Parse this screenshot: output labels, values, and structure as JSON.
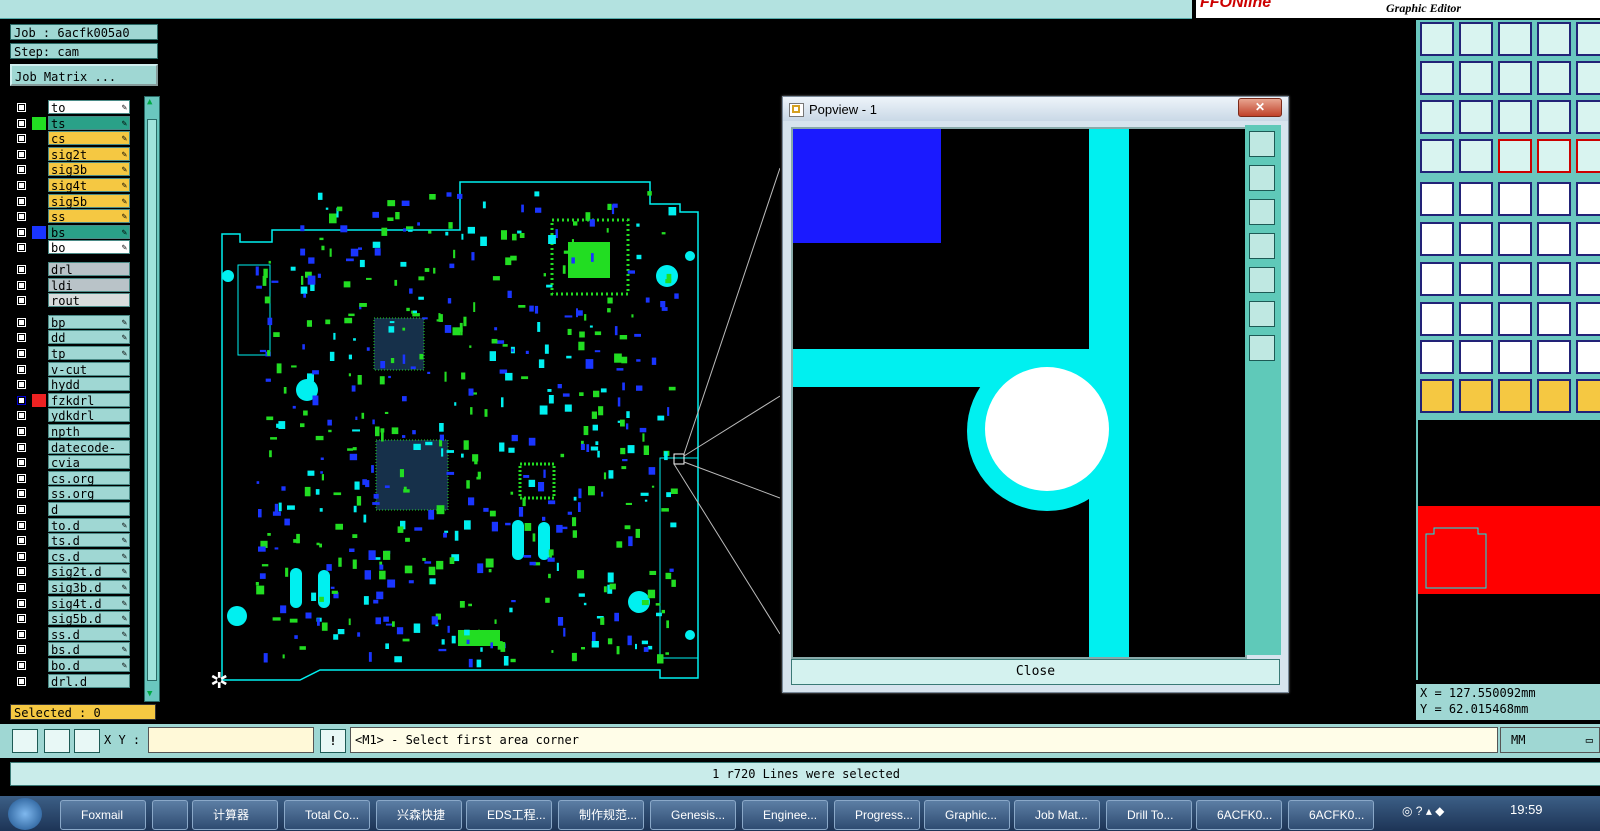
{
  "brand": {
    "logo": "FFONline",
    "subtitle": "Graphic Editor"
  },
  "job": {
    "job_label": "Job : 6acfk005a0",
    "step_label": "Step: cam",
    "matrix_button": "Job Matrix ..."
  },
  "layers": [
    {
      "name": "to",
      "bg": "#ffffff",
      "swatch": "#000000",
      "edit": true
    },
    {
      "name": "ts",
      "bg": "#2aa188",
      "swatch": "#22dd22",
      "edit": true
    },
    {
      "name": "cs",
      "bg": "#f5c842",
      "swatch": "#000000",
      "edit": true
    },
    {
      "name": "sig2t",
      "bg": "#f5c842",
      "swatch": "#000000",
      "edit": true
    },
    {
      "name": "sig3b",
      "bg": "#f5c842",
      "swatch": "#000000",
      "edit": true
    },
    {
      "name": "sig4t",
      "bg": "#f5c842",
      "swatch": "#000000",
      "edit": true
    },
    {
      "name": "sig5b",
      "bg": "#f5c842",
      "swatch": "#000000",
      "edit": true
    },
    {
      "name": "ss",
      "bg": "#f5c842",
      "swatch": "#000000",
      "edit": true
    },
    {
      "name": "bs",
      "bg": "#2aa188",
      "swatch": "#1a35ff",
      "edit": true
    },
    {
      "name": "bo",
      "bg": "#ffffff",
      "swatch": "#000000",
      "edit": true
    },
    {
      "name": "drl",
      "bg": "#b9c3c8",
      "swatch": "#000000",
      "edit": false
    },
    {
      "name": "ldi",
      "bg": "#b9c3c8",
      "swatch": "#000000",
      "edit": false
    },
    {
      "name": "rout",
      "bg": "#d8dcdc",
      "swatch": "#000000",
      "edit": false
    },
    {
      "name": "bp",
      "bg": "#9fd7d3",
      "swatch": "#000000",
      "edit": true
    },
    {
      "name": "dd",
      "bg": "#9fd7d3",
      "swatch": "#000000",
      "edit": true
    },
    {
      "name": "tp",
      "bg": "#9fd7d3",
      "swatch": "#000000",
      "edit": true
    },
    {
      "name": "v-cut",
      "bg": "#9fd7d3",
      "swatch": "#000000",
      "edit": false
    },
    {
      "name": "hydd",
      "bg": "#9fd7d3",
      "swatch": "#000000",
      "edit": false
    },
    {
      "name": "fzkdrl",
      "bg": "#9fd7d3",
      "swatch": "#ee2222",
      "edit": false,
      "active": true
    },
    {
      "name": "ydkdrl",
      "bg": "#9fd7d3",
      "swatch": "#000000",
      "edit": false
    },
    {
      "name": "npth",
      "bg": "#9fd7d3",
      "swatch": "#000000",
      "edit": false
    },
    {
      "name": "datecode-bo",
      "bg": "#9fd7d3",
      "swatch": "#000000",
      "edit": false
    },
    {
      "name": "cvia",
      "bg": "#9fd7d3",
      "swatch": "#000000",
      "edit": false
    },
    {
      "name": "cs.org",
      "bg": "#9fd7d3",
      "swatch": "#000000",
      "edit": false
    },
    {
      "name": "ss.org",
      "bg": "#9fd7d3",
      "swatch": "#000000",
      "edit": false
    },
    {
      "name": "d",
      "bg": "#9fd7d3",
      "swatch": "#000000",
      "edit": false
    },
    {
      "name": "to.d",
      "bg": "#9fd7d3",
      "swatch": "#000000",
      "edit": true
    },
    {
      "name": "ts.d",
      "bg": "#9fd7d3",
      "swatch": "#000000",
      "edit": true
    },
    {
      "name": "cs.d",
      "bg": "#9fd7d3",
      "swatch": "#000000",
      "edit": true
    },
    {
      "name": "sig2t.d",
      "bg": "#9fd7d3",
      "swatch": "#000000",
      "edit": true
    },
    {
      "name": "sig3b.d",
      "bg": "#9fd7d3",
      "swatch": "#000000",
      "edit": true
    },
    {
      "name": "sig4t.d",
      "bg": "#9fd7d3",
      "swatch": "#000000",
      "edit": true
    },
    {
      "name": "sig5b.d",
      "bg": "#9fd7d3",
      "swatch": "#000000",
      "edit": true
    },
    {
      "name": "ss.d",
      "bg": "#9fd7d3",
      "swatch": "#000000",
      "edit": true
    },
    {
      "name": "bs.d",
      "bg": "#9fd7d3",
      "swatch": "#000000",
      "edit": true
    },
    {
      "name": "bo.d",
      "bg": "#9fd7d3",
      "swatch": "#000000",
      "edit": true
    },
    {
      "name": "drl.d",
      "bg": "#9fd7d3",
      "swatch": "#000000",
      "edit": false
    }
  ],
  "selected_label": "Selected : 0",
  "popview": {
    "title": "Popview - 1",
    "close_label": "Close"
  },
  "coords": {
    "x": "X =  127.550092mm",
    "y": "Y =   62.015468mm"
  },
  "command": {
    "xy_label": "X Y :",
    "xy_value": "",
    "prompt": "<M1> - Select first area corner",
    "units": "MM"
  },
  "status_message": "1 r720 Lines were selected",
  "taskbar": {
    "items": [
      "Foxmail",
      "",
      "计算器",
      "Total Co...",
      "兴森快捷",
      "EDS工程...",
      "制作规范...",
      "Genesis...",
      "Enginee...",
      "Progress...",
      "Graphic...",
      "Job Mat...",
      "Drill To...",
      "6ACFK0...",
      "6ACFK0..."
    ],
    "clock": "19:59"
  },
  "colors": {
    "panel": "#9fd7d3",
    "cyan": "#00f0f0",
    "blue": "#1a35ff",
    "green": "#22dd22",
    "orange": "#f5c842"
  }
}
